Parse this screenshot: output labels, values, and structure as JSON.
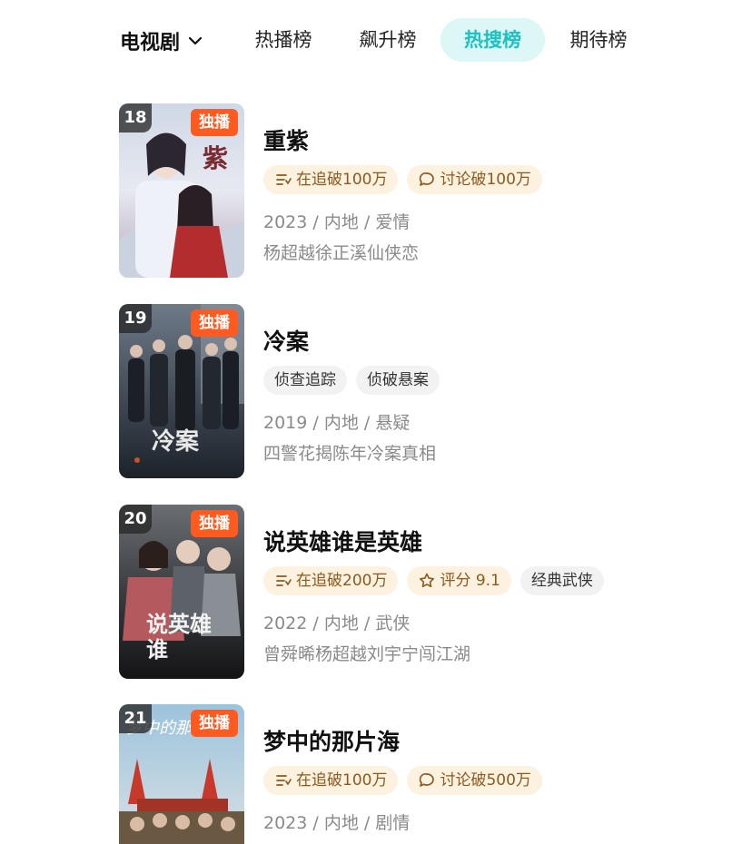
{
  "header": {
    "category": "电视剧",
    "tabs": [
      {
        "label": "热播榜",
        "active": false
      },
      {
        "label": "飙升榜",
        "active": false
      },
      {
        "label": "热搜榜",
        "active": true
      },
      {
        "label": "期待榜",
        "active": false
      }
    ]
  },
  "colors": {
    "accent": "#1cc2c2",
    "badge": "#ff5a1f",
    "tag_warm_bg": "#fdf1df"
  },
  "items": [
    {
      "rank": "18",
      "badge": "独播",
      "title": "重紫",
      "tags": [
        {
          "icon": "follow-list-icon",
          "text": "在追破100万",
          "style": "warm"
        },
        {
          "icon": "comment-bubble-icon",
          "text": "讨论破100万",
          "style": "warm"
        }
      ],
      "meta": "2023 / 内地 / 爱情",
      "desc": "杨超越徐正溪仙侠恋"
    },
    {
      "rank": "19",
      "badge": "独播",
      "title": "冷案",
      "tags": [
        {
          "text": "侦查追踪",
          "style": "plain"
        },
        {
          "text": "侦破悬案",
          "style": "plain"
        }
      ],
      "meta": "2019 / 内地 / 悬疑",
      "desc": "四警花揭陈年冷案真相"
    },
    {
      "rank": "20",
      "badge": "独播",
      "title": "说英雄谁是英雄",
      "tags": [
        {
          "icon": "follow-list-icon",
          "text": "在追破200万",
          "style": "warm"
        },
        {
          "icon": "star-icon",
          "text": "评分 9.1",
          "style": "warm"
        },
        {
          "text": "经典武侠",
          "style": "plain"
        }
      ],
      "meta": "2022 / 内地 / 武侠",
      "desc": "曾舜晞杨超越刘宇宁闯江湖"
    },
    {
      "rank": "21",
      "badge": "独播",
      "title": "梦中的那片海",
      "tags": [
        {
          "icon": "follow-list-icon",
          "text": "在追破100万",
          "style": "warm"
        },
        {
          "icon": "comment-bubble-icon",
          "text": "讨论破500万",
          "style": "warm"
        }
      ],
      "meta": "2023 / 内地 / 剧情",
      "desc": ""
    }
  ]
}
